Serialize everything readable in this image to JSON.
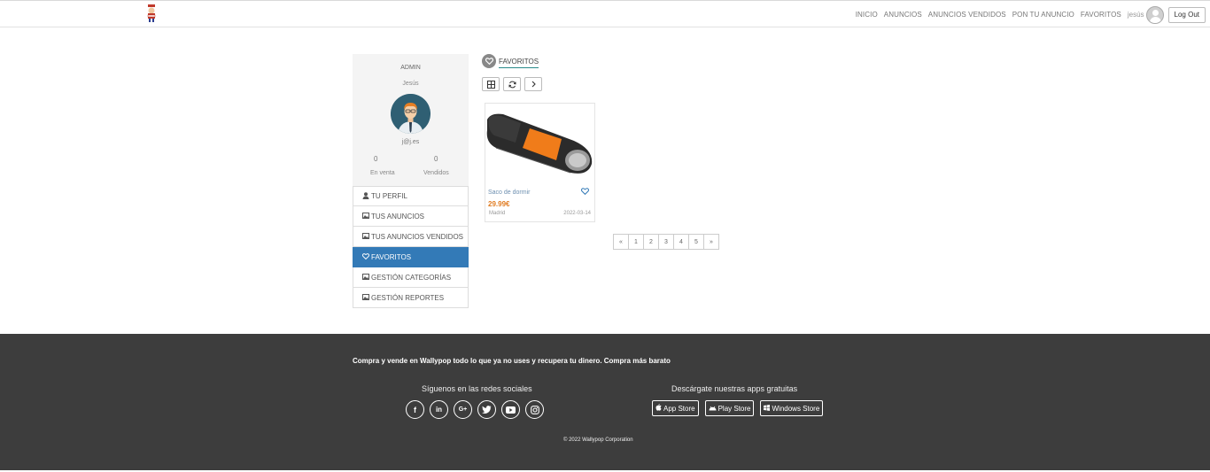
{
  "nav": {
    "items": [
      "INICIO",
      "ANUNCIOS",
      "ANUNCIOS VENDIDOS",
      "PON TU ANUNCIO",
      "FAVORITOS"
    ],
    "user": "jesús",
    "logout": "Log Out"
  },
  "profile": {
    "role": "ADMIN",
    "name": "Jesús",
    "email": "j@j.es",
    "for_sale_count": "0",
    "for_sale_label": "En venta",
    "sold_count": "0",
    "sold_label": "Vendidos"
  },
  "menu": [
    {
      "label": "TU PERFIL",
      "icon": "user-icon"
    },
    {
      "label": "TUS ANUNCIOS",
      "icon": "image-icon"
    },
    {
      "label": "TUS ANUNCIOS VENDIDOS",
      "icon": "image-icon"
    },
    {
      "label": "FAVORITOS",
      "icon": "heart-icon",
      "active": true
    },
    {
      "label": "GESTIÓN CATEGORÍAS",
      "icon": "image-icon"
    },
    {
      "label": "GESTIÓN REPORTES",
      "icon": "image-icon"
    }
  ],
  "favorites": {
    "title": "FAVORITOS",
    "tools": [
      "grid-icon",
      "refresh-icon",
      "chevron-right-icon"
    ],
    "products": [
      {
        "name": "Saco de dormir",
        "price": "29.99€",
        "location": "Madrid",
        "date": "2022-03-14"
      }
    ]
  },
  "pagination": [
    "«",
    "1",
    "2",
    "3",
    "4",
    "5",
    "»"
  ],
  "footer": {
    "tagline": "Compra y vende en Wallypop todo lo que ya no uses y recupera tu dinero. Compra más barato",
    "social_title": "Síguenos en las redes sociales",
    "apps_title": "Descárgate nuestras apps gratuitas",
    "apps": [
      "App Store",
      "Play Store",
      "Windows Store"
    ],
    "copyright": "© 2022 Wallypop Corporation"
  },
  "colors": {
    "accent": "#337ab7",
    "price": "#e07b20",
    "footer_bg": "#3d3d3d"
  }
}
